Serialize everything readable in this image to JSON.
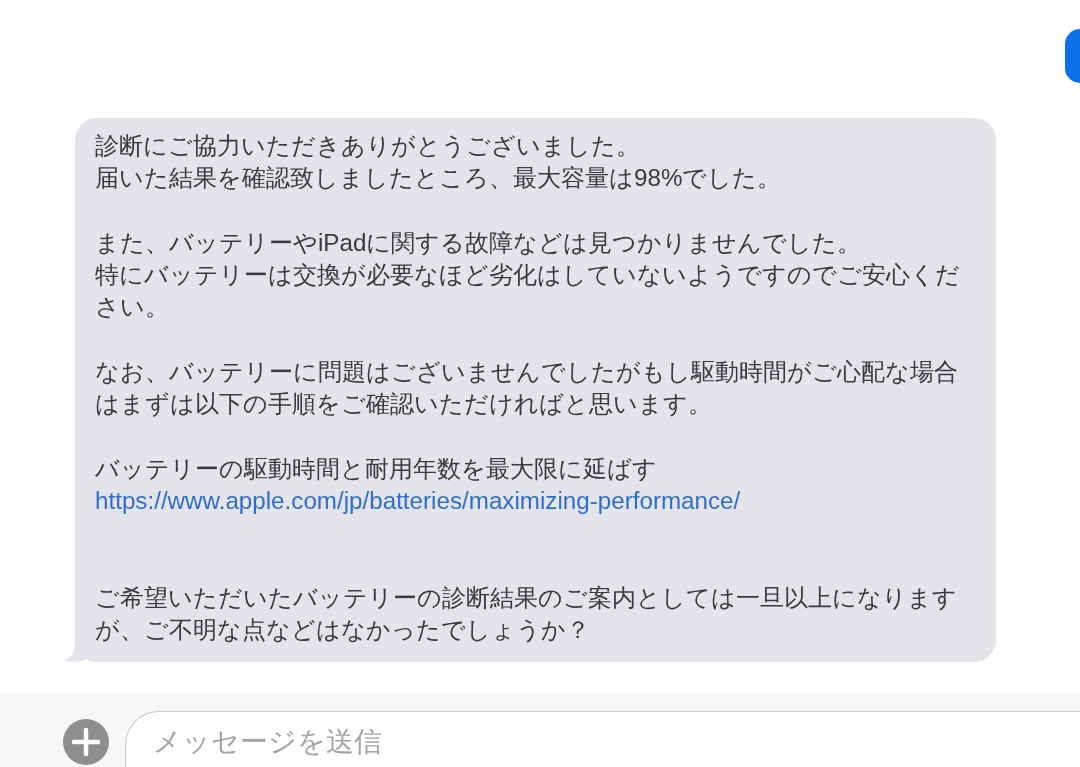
{
  "received_message": {
    "blocks": [
      {
        "kind": "text",
        "lines": [
          "診断にご協力いただきありがとうございました。",
          "届いた結果を確認致しましたところ、最大容量は98%でした。"
        ]
      },
      {
        "kind": "text",
        "lines": [
          "また、バッテリーやiPadに関する故障などは見つかりませんでした。",
          "特にバッテリーは交換が必要なほど劣化はしていないようですのでご安心ください。"
        ]
      },
      {
        "kind": "text",
        "lines": [
          "なお、バッテリーに問題はございませんでしたがもし駆動時間がご心配な場合はまずは以下の手順をご確認いただければと思います。"
        ]
      },
      {
        "kind": "text",
        "lines": [
          "バッテリーの駆動時間と耐用年数を最大限に延ばす"
        ]
      },
      {
        "kind": "link",
        "text": "https://www.apple.com/jp/batteries/maximizing-performance/"
      },
      {
        "kind": "text",
        "lines": [
          "ご希望いただいたバッテリーの診断結果のご案内としては一旦以上になりますが、ご不明な点などはなかったでしょうか？"
        ]
      }
    ]
  },
  "composer": {
    "placeholder": "メッセージを送信"
  }
}
